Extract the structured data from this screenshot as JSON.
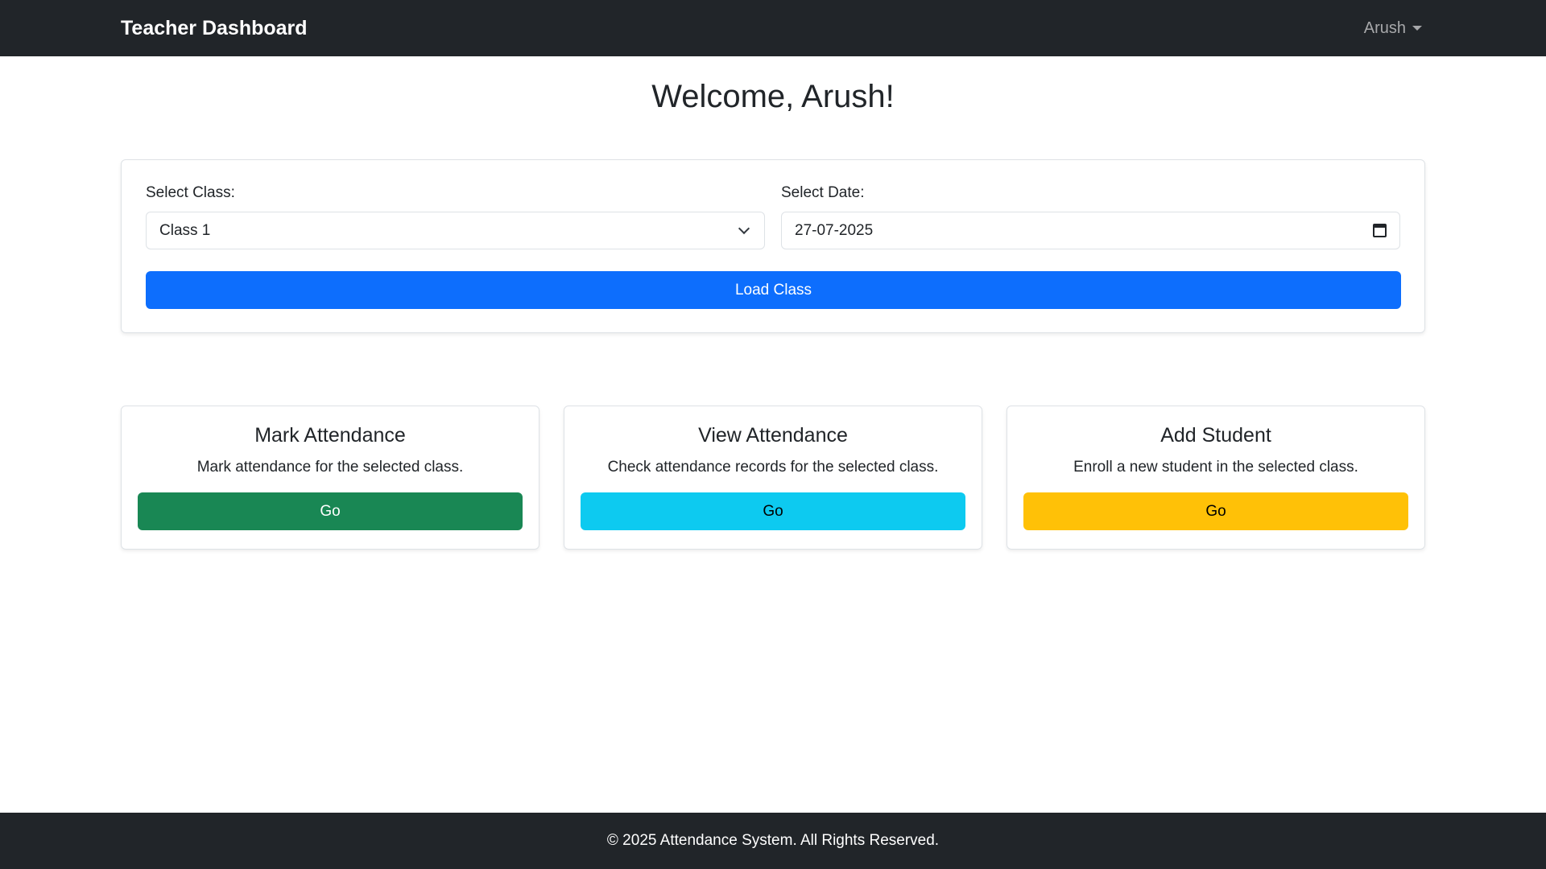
{
  "navbar": {
    "brand": "Teacher Dashboard",
    "user": "Arush"
  },
  "welcome": "Welcome, Arush!",
  "form": {
    "class_label": "Select Class:",
    "class_value": "Class 1",
    "date_label": "Select Date:",
    "date_value": "27-07-2025",
    "load_button": "Load Class"
  },
  "cards": [
    {
      "title": "Mark Attendance",
      "description": "Mark attendance for the selected class.",
      "button": "Go",
      "color": "#198754"
    },
    {
      "title": "View Attendance",
      "description": "Check attendance records for the selected class.",
      "button": "Go",
      "color": "#0dcaf0"
    },
    {
      "title": "Add Student",
      "description": "Enroll a new student in the selected class.",
      "button": "Go",
      "color": "#ffc107"
    }
  ],
  "footer": "© 2025 Attendance System. All Rights Reserved.",
  "colors": {
    "navbar": "#212529",
    "primary": "#0d6efd"
  },
  "icons": {
    "class_select": "chevron-down-icon",
    "date_picker": "calendar-icon",
    "user_menu": "caret-down-icon"
  }
}
